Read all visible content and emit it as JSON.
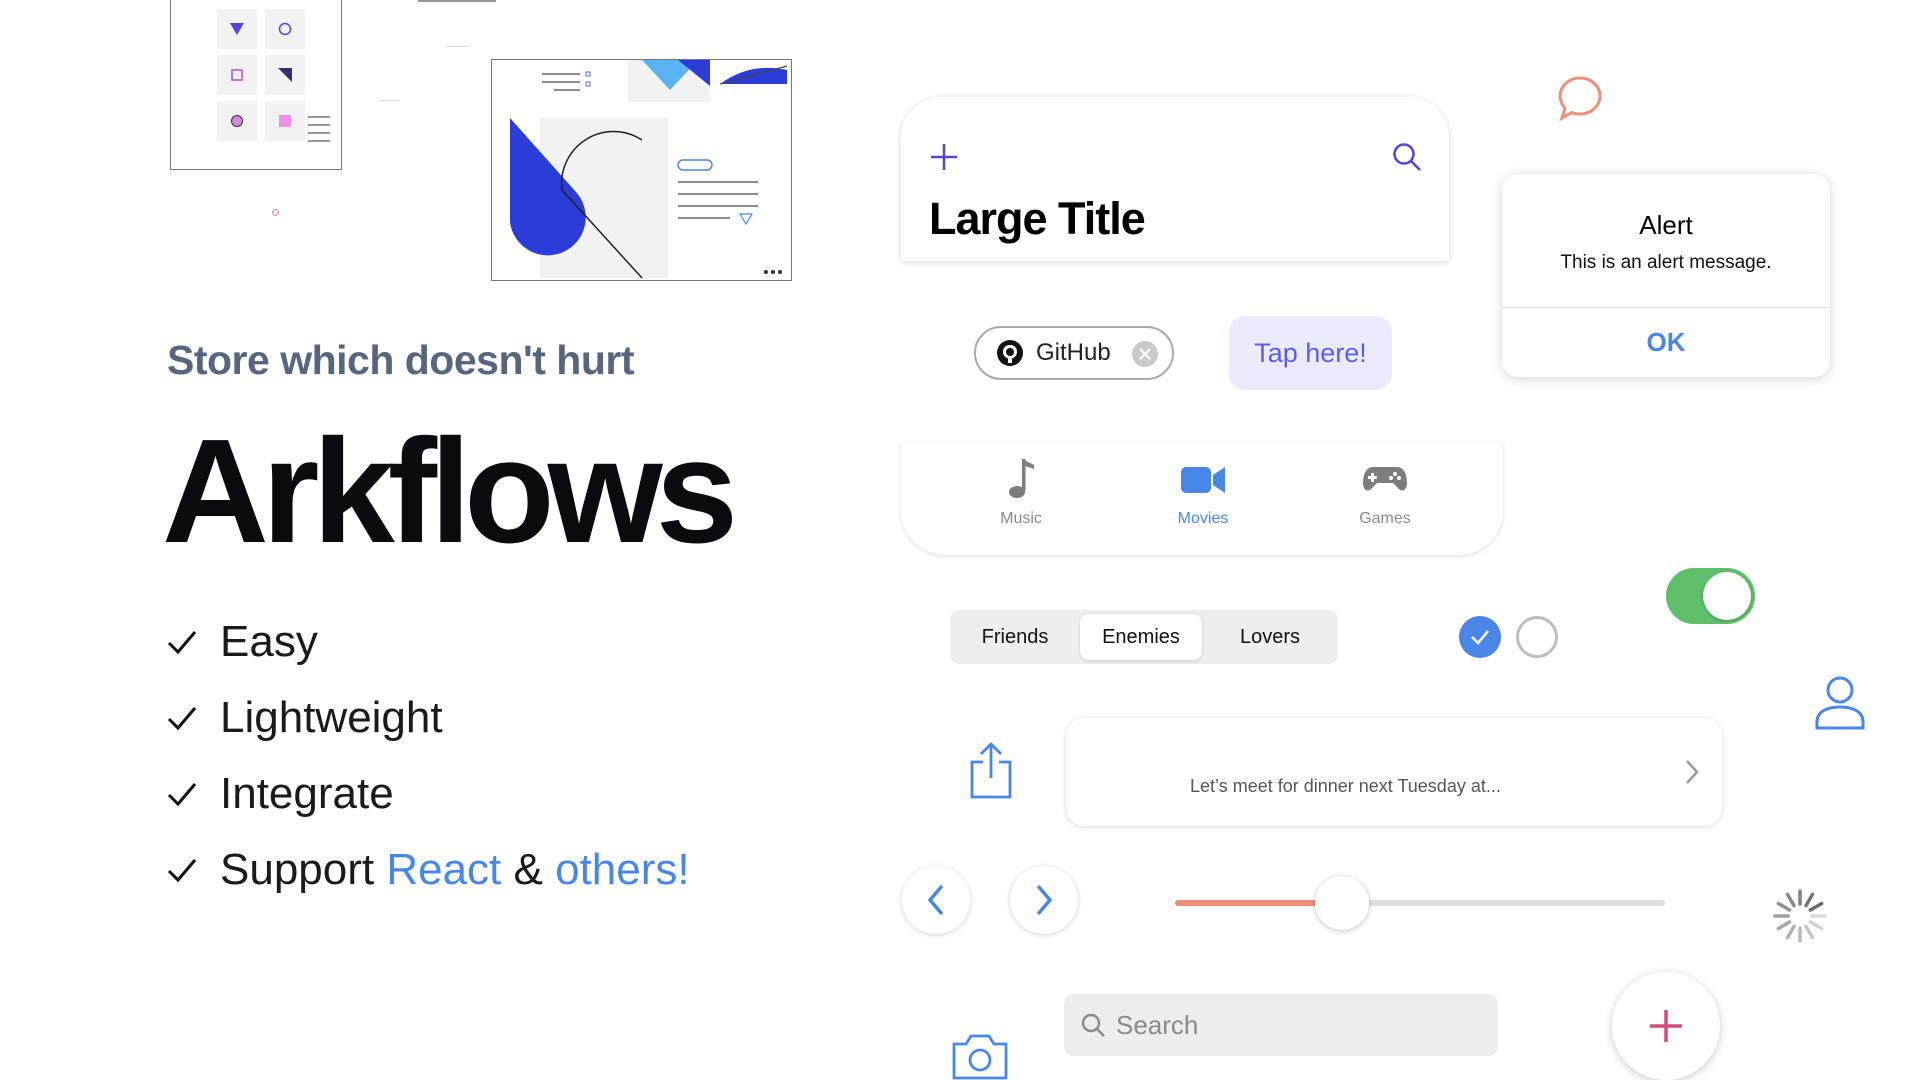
{
  "hero": {
    "tagline": "Store which doesn't hurt",
    "brand": "Arkflows",
    "features": [
      {
        "text": "Easy"
      },
      {
        "text": "Lightweight"
      },
      {
        "text": "Integrate"
      }
    ],
    "support": {
      "prefix": "Support ",
      "link1": "React",
      "amp": " & ",
      "link2": "others!"
    }
  },
  "title_card": {
    "title": "Large Title",
    "left_icon": "plus-icon",
    "right_icon": "search-icon"
  },
  "chip": {
    "label": "GitHub",
    "icon": "github-icon"
  },
  "tap_button": {
    "label": "Tap here!"
  },
  "tabbar": {
    "tabs": [
      {
        "label": "Music",
        "icon": "music-note-icon"
      },
      {
        "label": "Movies",
        "icon": "video-camera-icon",
        "active": true
      },
      {
        "label": "Games",
        "icon": "gamepad-icon"
      }
    ]
  },
  "segmented": {
    "options": [
      "Friends",
      "Enemies",
      "Lovers"
    ],
    "selected": "Enemies"
  },
  "checkboxes": [
    {
      "checked": true
    },
    {
      "checked": false
    }
  ],
  "toggle": {
    "on": true
  },
  "alert": {
    "title": "Alert",
    "message": "This is an alert message.",
    "button": "OK"
  },
  "message": {
    "text": "Let’s meet for dinner next Tuesday at..."
  },
  "slider": {
    "value": 0.34
  },
  "search": {
    "placeholder": "Search"
  },
  "icons": {
    "chat": "chat-bubble-icon",
    "user": "user-icon",
    "share": "share-icon",
    "spinner": "spinner-icon",
    "camera": "camera-icon",
    "fab": "plus-icon"
  },
  "colors": {
    "accent": "#4a86e8",
    "indigo": "#5a5ef0",
    "toggle": "#5fbf6a",
    "slider": "#ee8f7a",
    "fab_plus": "#d64b77",
    "chat": "#ee8f7a",
    "brand_text": "#0b0b0f",
    "tagline": "#56667f"
  }
}
